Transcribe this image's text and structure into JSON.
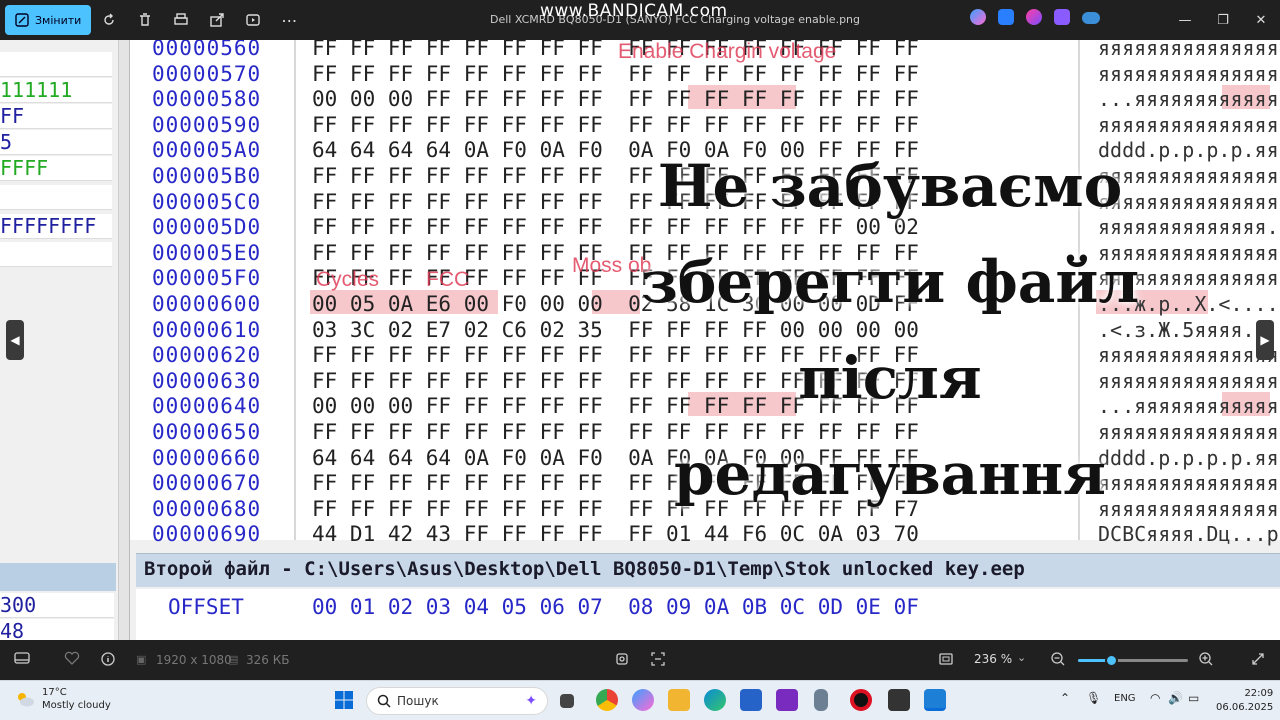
{
  "titlebar": {
    "edit_label": "Змінити",
    "title": "Dell XCMRD BQ8050-D1 (SANYO) FCC Charging voltage enable.png",
    "watermark": "www.BANDICAM.com"
  },
  "left_panel": {
    "rows": [
      "111111",
      "FF",
      "5",
      "FFFF",
      "",
      "FFFFFFFF",
      ""
    ],
    "bottom_rows": [
      "300",
      "48"
    ]
  },
  "hex": {
    "offsets": [
      "00000560",
      "00000570",
      "00000580",
      "00000590",
      "000005A0",
      "000005B0",
      "000005C0",
      "000005D0",
      "000005E0",
      "000005F0",
      "00000600",
      "00000610",
      "00000620",
      "00000630",
      "00000640",
      "00000650",
      "00000660",
      "00000670",
      "00000680",
      "00000690"
    ],
    "rows": [
      "FF FF FF FF FF FF FF FF  FF FF FF FF FF FF FF FF",
      "FF FF FF FF FF FF FF FF  FF FF FF FF FF FF FF FF",
      "00 00 00 FF FF FF FF FF  FF FF FF FF FF FF FF FF",
      "FF FF FF FF FF FF FF FF  FF FF FF FF FF FF FF FF",
      "64 64 64 64 0A F0 0A F0  0A F0 0A F0 00 FF FF FF",
      "FF FF FF FF FF FF FF FF  FF FF FF FF FF FF FF FF",
      "FF FF FF FF FF FF FF FF  FF FF FF FF FF FF FF FF",
      "FF FF FF FF FF FF FF FF  FF FF FF FF FF FF 00 02",
      "FF FF FF FF FF FF FF FF  FF FF FF FF FF FF FF FF",
      "FF FF FF FF FF FF FF FF  FF FF FF FF FF FF FF FF",
      "00 05 0A E6 00 F0 00 00  02 58 1C 3C 00 00 0D FF",
      "03 3C 02 E7 02 C6 02 35  FF FF FF FF 00 00 00 00",
      "FF FF FF FF FF FF FF FF  FF FF FF FF FF FF FF FF",
      "FF FF FF FF FF FF FF FF  FF FF FF FF FF FF FF FF",
      "00 00 00 FF FF FF FF FF  FF FF FF FF FF FF FF FF",
      "FF FF FF FF FF FF FF FF  FF FF FF FF FF FF FF FF",
      "64 64 64 64 0A F0 0A F0  0A F0 0A F0 00 FF FF FF",
      "FF FF FF FF FF FF FF FF  FF FF FF FF FF FF FF FF",
      "FF FF FF FF FF FF FF FF  FF FF FF FF FF FF FF F7",
      "44 D1 42 43 FF FF FF FF  FF 01 44 F6 0C 0A 03 70"
    ],
    "ascii": [
      "яяяяяяяяяяяяяяяя",
      "яяяяяяяяяяяяяяяя",
      "...яяяяяяяяяяяяя",
      "яяяяяяяяяяяяяяяя",
      "dddd.p.p.p.p.яяя",
      "яяяяяяяяяяяяяяяя",
      "яяяяяяяяяяяяяяяя",
      "яяяяяяяяяяяяяя..",
      "яяяяяяяяяяяяяяяя",
      "яяяяяяяяяяяяяяяя",
      "...ж.р..X.<....я",
      ".<.з.Ж.5яяяя....",
      "яяяяяяяяяяяяяяяя",
      "яяяяяяяяяяяяяяяя",
      "...яяяяяяяяяяяяя",
      "яяяяяяяяяяяяяяяя",
      "dddd.p.p.p.p.яяя",
      "яяяяяяяяяяяяяяяя",
      "яяяяяяяяяяяяяяяч",
      "DCBCяяяя.Dц...p"
    ],
    "labels": {
      "enable": "Enable Chargin voltage",
      "cycles": "Cycles",
      "fcc": "FCC",
      "moss": "Moss ob"
    },
    "second_file": "Второй файл - C:\\Users\\Asus\\Desktop\\Dell BQ8050-D1\\Temp\\Stok unlocked key.eep",
    "offset_label": "OFFSET",
    "offset_cols": "00 01 02 03 04 05 06 07  08 09 0A 0B 0C 0D 0E 0F"
  },
  "overlay_lines": [
    "Не забуваємо",
    "зберегти файл",
    "після",
    "редагування"
  ],
  "viewer": {
    "dimensions": "1920 x 1080",
    "size": "326 КБ",
    "zoom": "236 %",
    "zoom_fraction": 0.3
  },
  "taskbar": {
    "temp": "17°C",
    "weather": "Mostly cloudy",
    "search_placeholder": "Пошук",
    "lang": "ENG",
    "time": "22:09",
    "date": "06.06.2025"
  },
  "colors": {
    "accent": "#4cc2ff",
    "highlight": "#f6c8cc",
    "offset_blue": "#2828c8",
    "left_green": "#22aa22"
  }
}
